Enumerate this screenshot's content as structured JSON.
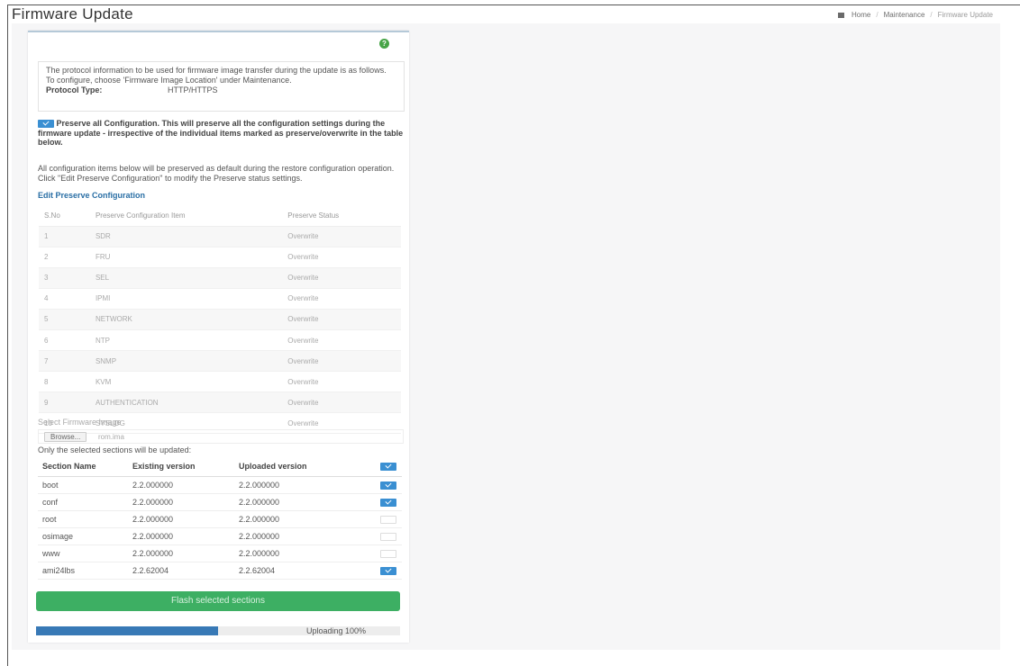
{
  "header": {
    "title": "Firmware Update",
    "breadcrumb": [
      "Home",
      "Maintenance",
      "Firmware Update"
    ]
  },
  "info": {
    "text": "The protocol information to be used for firmware image transfer during the update is as follows. To configure, choose 'Firmware Image Location' under Maintenance.",
    "protocol_label": "Protocol Type:",
    "protocol_value": "HTTP/HTTPS"
  },
  "preserve_all": {
    "checked": true,
    "title": "Preserve all Configuration.",
    "text": " This will preserve all the configuration settings during the firmware update - irrespective of the individual items marked as preserve/overwrite in the table below."
  },
  "note": "All configuration items below will be preserved as default during the restore configuration operation. Click \"Edit Preserve Configuration\" to modify the Preserve status settings.",
  "edit_link": "Edit Preserve Configuration",
  "preserve_table": {
    "headers": [
      "S.No",
      "Preserve Configuration Item",
      "Preserve Status"
    ],
    "rows": [
      [
        "1",
        "SDR",
        "Overwrite"
      ],
      [
        "2",
        "FRU",
        "Overwrite"
      ],
      [
        "3",
        "SEL",
        "Overwrite"
      ],
      [
        "4",
        "IPMI",
        "Overwrite"
      ],
      [
        "5",
        "NETWORK",
        "Overwrite"
      ],
      [
        "6",
        "NTP",
        "Overwrite"
      ],
      [
        "7",
        "SNMP",
        "Overwrite"
      ],
      [
        "8",
        "KVM",
        "Overwrite"
      ],
      [
        "9",
        "AUTHENTICATION",
        "Overwrite"
      ],
      [
        "10",
        "SYSLOG",
        "Overwrite"
      ]
    ]
  },
  "firmware": {
    "label": "Select Firmware Image",
    "browse_label": "Browse...",
    "file_name": "rom.ima"
  },
  "sections_note": "Only the selected sections will be updated:",
  "section_table": {
    "headers": [
      "Section Name",
      "Existing version",
      "Uploaded version"
    ],
    "header_checked": true,
    "rows": [
      {
        "name": "boot",
        "existing": "2.2.000000",
        "uploaded": "2.2.000000",
        "checked": true
      },
      {
        "name": "conf",
        "existing": "2.2.000000",
        "uploaded": "2.2.000000",
        "checked": true
      },
      {
        "name": "root",
        "existing": "2.2.000000",
        "uploaded": "2.2.000000",
        "checked": false
      },
      {
        "name": "osimage",
        "existing": "2.2.000000",
        "uploaded": "2.2.000000",
        "checked": false
      },
      {
        "name": "www",
        "existing": "2.2.000000",
        "uploaded": "2.2.000000",
        "checked": false
      },
      {
        "name": "ami24lbs",
        "existing": "2.2.62004",
        "uploaded": "2.2.62004",
        "checked": true
      }
    ]
  },
  "flash_button": "Flash selected sections",
  "progress": {
    "label": "Uploading 100%",
    "bar_fraction": 0.5
  }
}
